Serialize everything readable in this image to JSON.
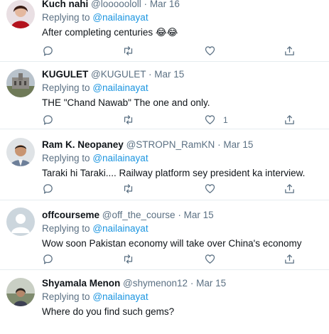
{
  "reply_prefix": "Replying to",
  "tweets": [
    {
      "name": "Kuch nahi",
      "handle": "@looooololl",
      "sep": "·",
      "date": "Mar 16",
      "reply_to": "@nailainayat",
      "text": "After completing centuries 😂😂",
      "likes": ""
    },
    {
      "name": "KUGULET",
      "handle": "@KUGULET",
      "sep": "·",
      "date": "Mar 15",
      "reply_to": "@nailainayat",
      "text": "THE \"Chand Nawab\" The one and only.",
      "likes": "1"
    },
    {
      "name": "Ram K. Neopaney",
      "handle": "@STROPN_RamKN",
      "sep": "·",
      "date": "Mar 15",
      "reply_to": "@nailainayat",
      "text": "Taraki hi Taraki.... Railway platform sey president ka interview.",
      "likes": ""
    },
    {
      "name": "offcourseme",
      "handle": "@off_the_course",
      "sep": "·",
      "date": "Mar 15",
      "reply_to": "@nailainayat",
      "text": "Wow soon Pakistan economy will take over China's economy",
      "likes": ""
    },
    {
      "name": "Shyamala Menon",
      "handle": "@shymenon12",
      "sep": "·",
      "date": "Mar 15",
      "reply_to": "@nailainayat",
      "text": "Where do you find such gems?",
      "likes": ""
    }
  ],
  "icons": {
    "reply": "reply-icon",
    "retweet": "retweet-icon",
    "like": "heart-icon",
    "share": "share-icon"
  }
}
